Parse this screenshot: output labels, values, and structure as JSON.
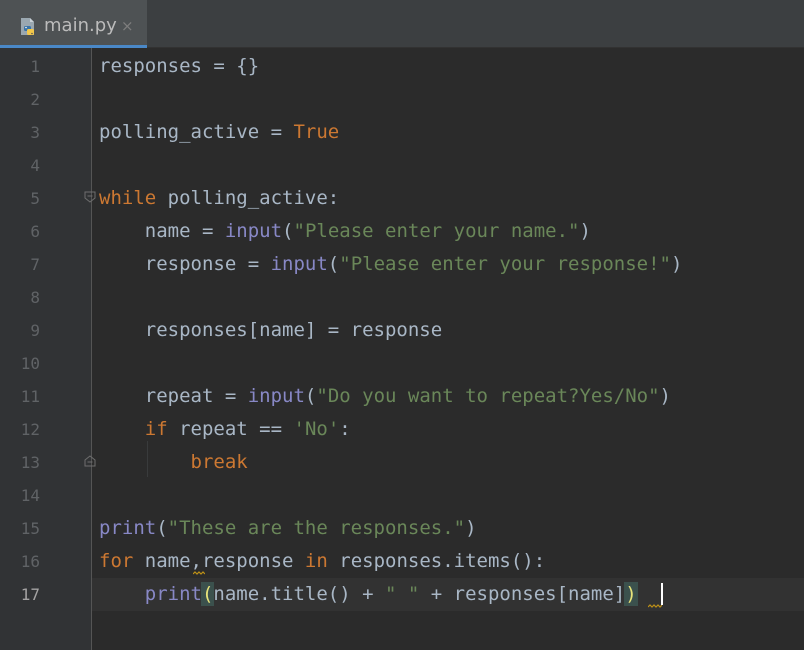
{
  "tab": {
    "filename": "main.py",
    "close_glyph": "×",
    "icon": "python-file-icon"
  },
  "colors": {
    "keyword": "#CC7832",
    "string": "#6A8759",
    "builtin": "#8888C6",
    "plain": "#A9B7C6",
    "background": "#2B2B2B"
  },
  "current_line": 17,
  "lines": [
    {
      "n": "1",
      "tokens": [
        [
          "pl",
          "responses = {}"
        ]
      ]
    },
    {
      "n": "2",
      "tokens": []
    },
    {
      "n": "3",
      "tokens": [
        [
          "pl",
          "polling_active = "
        ],
        [
          "kw",
          "True"
        ]
      ]
    },
    {
      "n": "4",
      "tokens": []
    },
    {
      "n": "5",
      "tokens": [
        [
          "kw",
          "while"
        ],
        [
          "pl",
          " polling_active:"
        ]
      ]
    },
    {
      "n": "6",
      "tokens": [
        [
          "pl",
          "    name = "
        ],
        [
          "bi",
          "input"
        ],
        [
          "pl",
          "("
        ],
        [
          "str",
          "\"Please enter your name.\""
        ],
        [
          "pl",
          ")"
        ]
      ]
    },
    {
      "n": "7",
      "tokens": [
        [
          "pl",
          "    response = "
        ],
        [
          "bi",
          "input"
        ],
        [
          "pl",
          "("
        ],
        [
          "str",
          "\"Please enter your response!\""
        ],
        [
          "pl",
          ")"
        ]
      ]
    },
    {
      "n": "8",
      "tokens": []
    },
    {
      "n": "9",
      "tokens": [
        [
          "pl",
          "    responses[name] = response"
        ]
      ]
    },
    {
      "n": "10",
      "tokens": []
    },
    {
      "n": "11",
      "tokens": [
        [
          "pl",
          "    repeat = "
        ],
        [
          "bi",
          "input"
        ],
        [
          "pl",
          "("
        ],
        [
          "str",
          "\"Do you want to repeat?Yes/No\""
        ],
        [
          "pl",
          ")"
        ]
      ]
    },
    {
      "n": "12",
      "tokens": [
        [
          "pl",
          "    "
        ],
        [
          "kw",
          "if"
        ],
        [
          "pl",
          " repeat == "
        ],
        [
          "str",
          "'No'"
        ],
        [
          "pl",
          ":"
        ]
      ]
    },
    {
      "n": "13",
      "tokens": [
        [
          "pl",
          "        "
        ],
        [
          "kw",
          "break"
        ]
      ]
    },
    {
      "n": "14",
      "tokens": []
    },
    {
      "n": "15",
      "tokens": [
        [
          "bi",
          "print"
        ],
        [
          "pl",
          "("
        ],
        [
          "str",
          "\"These are the responses.\""
        ],
        [
          "pl",
          ")"
        ]
      ]
    },
    {
      "n": "16",
      "tokens": [
        [
          "kw",
          "for"
        ],
        [
          "pl",
          " name,response "
        ],
        [
          "kw",
          "in"
        ],
        [
          "pl",
          " responses.items():"
        ]
      ]
    },
    {
      "n": "17",
      "tokens": [
        [
          "pl",
          "    "
        ],
        [
          "bi",
          "print"
        ],
        [
          "brk",
          "("
        ],
        [
          "pl",
          "name.title() + "
        ],
        [
          "str",
          "\" \""
        ],
        [
          "pl",
          " + responses[name]"
        ],
        [
          "brk",
          ")"
        ]
      ]
    }
  ]
}
